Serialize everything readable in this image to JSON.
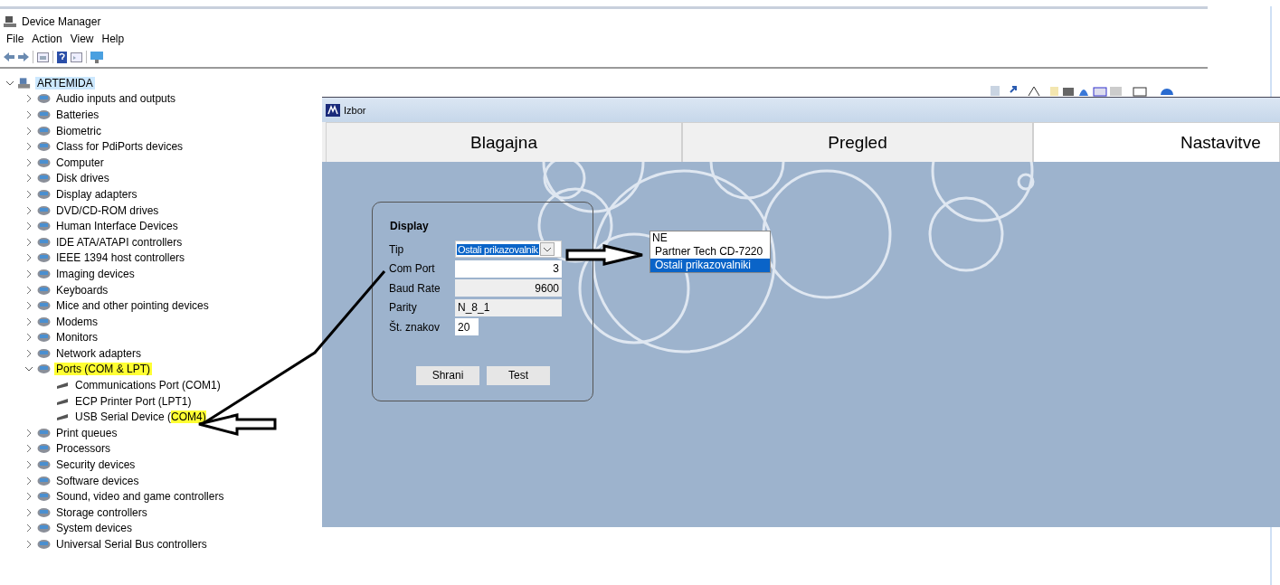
{
  "device_manager": {
    "title": "Device Manager",
    "menu": [
      "File",
      "Action",
      "View",
      "Help"
    ],
    "tree": {
      "label": "ARTEMIDA",
      "expanded": true,
      "selected": true,
      "children": [
        {
          "label": "Audio inputs and outputs",
          "expanded": false
        },
        {
          "label": "Batteries",
          "expanded": false
        },
        {
          "label": "Biometric",
          "expanded": false
        },
        {
          "label": "Class for PdiPorts devices",
          "expanded": false
        },
        {
          "label": "Computer",
          "expanded": false
        },
        {
          "label": "Disk drives",
          "expanded": false
        },
        {
          "label": "Display adapters",
          "expanded": false
        },
        {
          "label": "DVD/CD-ROM drives",
          "expanded": false
        },
        {
          "label": "Human Interface Devices",
          "expanded": false
        },
        {
          "label": "IDE ATA/ATAPI controllers",
          "expanded": false
        },
        {
          "label": "IEEE 1394 host controllers",
          "expanded": false
        },
        {
          "label": "Imaging devices",
          "expanded": false
        },
        {
          "label": "Keyboards",
          "expanded": false
        },
        {
          "label": "Mice and other pointing devices",
          "expanded": false
        },
        {
          "label": "Modems",
          "expanded": false
        },
        {
          "label": "Monitors",
          "expanded": false
        },
        {
          "label": "Network adapters",
          "expanded": false
        },
        {
          "label": "Ports (COM & LPT)",
          "expanded": true,
          "highlighted": true,
          "children": [
            {
              "label": "Communications Port (COM1)"
            },
            {
              "label": "ECP Printer Port (LPT1)"
            },
            {
              "label": "USB Serial Device (",
              "highlighted_part": "COM4)"
            }
          ]
        },
        {
          "label": "Print queues",
          "expanded": false
        },
        {
          "label": "Processors",
          "expanded": false
        },
        {
          "label": "Security devices",
          "expanded": false
        },
        {
          "label": "Software devices",
          "expanded": false
        },
        {
          "label": "Sound, video and game controllers",
          "expanded": false
        },
        {
          "label": "Storage controllers",
          "expanded": false
        },
        {
          "label": "System devices",
          "expanded": false
        },
        {
          "label": "Universal Serial Bus controllers",
          "expanded": false
        }
      ]
    }
  },
  "izbor": {
    "title": "Izbor",
    "tabs": [
      {
        "label": "Blagajna",
        "selected": false
      },
      {
        "label": "Pregled",
        "selected": false
      },
      {
        "label": "Nastavitve",
        "selected": true
      }
    ],
    "display": {
      "title": "Display",
      "fields": [
        {
          "kind": "combo",
          "label": "Tip",
          "value": "Ostali prikazovalnik"
        },
        {
          "kind": "number",
          "label": "Com Port",
          "value": "3",
          "disabled": false
        },
        {
          "kind": "number",
          "label": "Baud Rate",
          "value": "9600",
          "disabled": true
        },
        {
          "kind": "text",
          "label": "Parity",
          "value": "N_8_1",
          "disabled": true
        },
        {
          "kind": "short",
          "label": "Št. znakov",
          "value": "20",
          "disabled": false
        }
      ],
      "buttons": [
        "Shrani",
        "Test"
      ]
    },
    "dropdown_list": [
      {
        "label": "NE",
        "selected": false
      },
      {
        "label": "Partner Tech CD-7220",
        "selected": false
      },
      {
        "label": "Ostali prikazovalniki",
        "selected": true
      }
    ]
  }
}
